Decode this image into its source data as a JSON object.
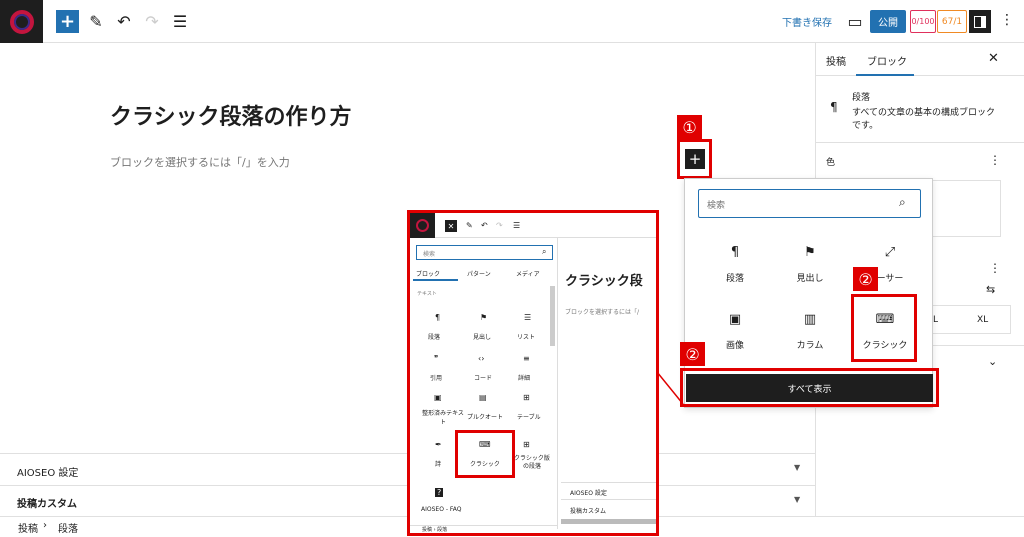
{
  "toolbar": {
    "save_draft": "下書き保存",
    "publish": "公開",
    "aioseo_score": "0/100",
    "trueseo_score": "67/1"
  },
  "editor": {
    "title": "クラシック段落の作り方",
    "placeholder": "ブロックを選択するには「/」を入力"
  },
  "panels": [
    {
      "label": "AIOSEO 設定"
    },
    {
      "label": "投稿カスタム"
    }
  ],
  "breadcrumb": {
    "root": "投稿",
    "sep": "›",
    "current": "段落"
  },
  "sidebar": {
    "tab_post": "投稿",
    "tab_block": "ブロック",
    "block_name": "段落",
    "block_desc": "すべての文章の基本の構成ブロックです。",
    "color_label": "色",
    "size_xl": "XL",
    "size_l": "L"
  },
  "inserter": {
    "search_placeholder": "検索",
    "blocks": [
      {
        "label": "段落",
        "icon": "¶"
      },
      {
        "label": "見出し",
        "icon": "⚑"
      },
      {
        "label": "ーサー",
        "icon": "⤢"
      },
      {
        "label": "画像",
        "icon": "▣"
      },
      {
        "label": "カラム",
        "icon": "▥"
      },
      {
        "label": "クラシック",
        "icon": "⌨"
      }
    ],
    "show_all": "すべて表示"
  },
  "markers": {
    "one": "①",
    "two": "②"
  },
  "inset": {
    "search_placeholder": "検索",
    "tabs": [
      "ブロック",
      "パターン",
      "メディア"
    ],
    "section": "テキスト",
    "blocks": [
      [
        "段落",
        "見出し",
        "リスト"
      ],
      [
        "引用",
        "コード",
        "詳細"
      ],
      [
        "整形済みテキスト",
        "プルクオート",
        "テーブル"
      ],
      [
        "詩",
        "クラシック",
        "クラシック版の段落"
      ]
    ],
    "extra": "AIOSEO - FAQ",
    "title": "クラシック段",
    "placeholder": "ブロックを選択するには「/",
    "panels": [
      "AIOSEO 設定",
      "投稿カスタム"
    ],
    "breadcrumb": "投稿 › 段落"
  }
}
